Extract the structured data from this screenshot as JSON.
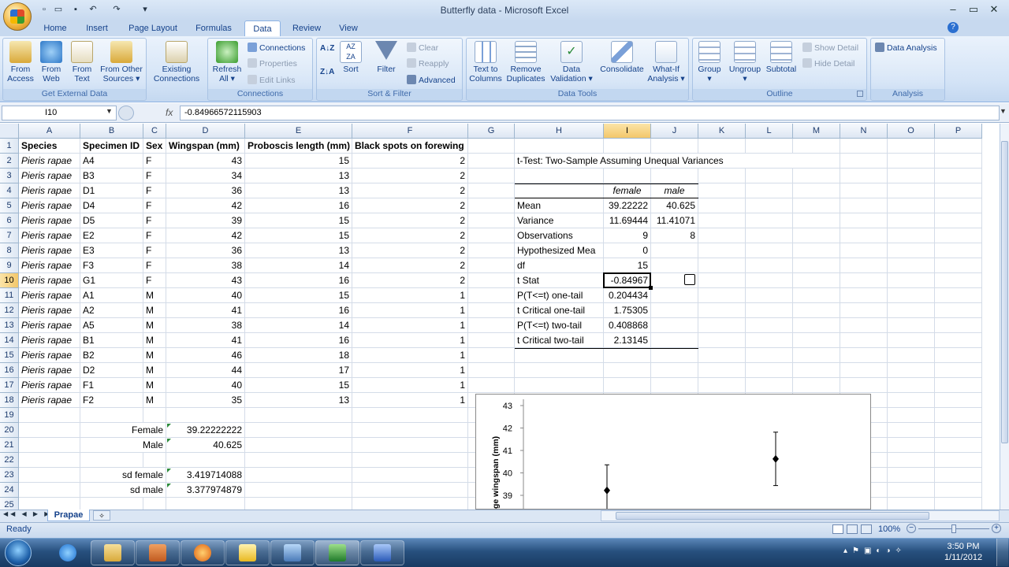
{
  "app": {
    "title": "Butterfly data - Microsoft Excel"
  },
  "tabs": [
    "Home",
    "Insert",
    "Page Layout",
    "Formulas",
    "Data",
    "Review",
    "View"
  ],
  "ribbon": {
    "groups": {
      "external": "Get External Data",
      "connections": "Connections",
      "sort_filter": "Sort & Filter",
      "data_tools": "Data Tools",
      "outline": "Outline",
      "analysis": "Analysis"
    },
    "from_access": [
      "From",
      "Access"
    ],
    "from_web": [
      "From",
      "Web"
    ],
    "from_text": [
      "From",
      "Text"
    ],
    "from_other": [
      "From Other",
      "Sources ▾"
    ],
    "existing": [
      "Existing",
      "Connections"
    ],
    "refresh": [
      "Refresh",
      "All ▾"
    ],
    "connections": "Connections",
    "properties": "Properties",
    "edit_links": "Edit Links",
    "sort": "Sort",
    "filter": "Filter",
    "clear": "Clear",
    "reapply": "Reapply",
    "advanced": "Advanced",
    "text_to_columns": [
      "Text to",
      "Columns"
    ],
    "remove_duplicates": [
      "Remove",
      "Duplicates"
    ],
    "data_validation": [
      "Data",
      "Validation ▾"
    ],
    "consolidate": "Consolidate",
    "what_if": [
      "What-If",
      "Analysis ▾"
    ],
    "group": [
      "Group",
      "▾"
    ],
    "ungroup": [
      "Ungroup",
      "▾"
    ],
    "subtotal": "Subtotal",
    "show_detail": "Show Detail",
    "hide_detail": "Hide Detail",
    "data_analysis": "Data Analysis"
  },
  "formula_bar": {
    "name_box": "I10",
    "fx": "fx",
    "formula": "-0.84966572115903"
  },
  "columns": [
    "A",
    "B",
    "C",
    "D",
    "E",
    "F",
    "G",
    "H",
    "I",
    "J",
    "K",
    "L",
    "M",
    "N",
    "O",
    "P"
  ],
  "rows": [
    "1",
    "2",
    "3",
    "4",
    "5",
    "6",
    "7",
    "8",
    "9",
    "10",
    "11",
    "12",
    "13",
    "14",
    "15",
    "16",
    "17",
    "18",
    "19",
    "20",
    "21",
    "22",
    "23",
    "24",
    "25"
  ],
  "headers": [
    "Species",
    "Specimen ID",
    "Sex",
    "Wingspan (mm)",
    "Proboscis length (mm)",
    "Black spots on forewing"
  ],
  "data": [
    [
      "Pieris rapae",
      "A4",
      "F",
      "43",
      "15",
      "2"
    ],
    [
      "Pieris rapae",
      "B3",
      "F",
      "34",
      "13",
      "2"
    ],
    [
      "Pieris rapae",
      "D1",
      "F",
      "36",
      "13",
      "2"
    ],
    [
      "Pieris rapae",
      "D4",
      "F",
      "42",
      "16",
      "2"
    ],
    [
      "Pieris rapae",
      "D5",
      "F",
      "39",
      "15",
      "2"
    ],
    [
      "Pieris rapae",
      "E2",
      "F",
      "42",
      "15",
      "2"
    ],
    [
      "Pieris rapae",
      "E3",
      "F",
      "36",
      "13",
      "2"
    ],
    [
      "Pieris rapae",
      "F3",
      "F",
      "38",
      "14",
      "2"
    ],
    [
      "Pieris rapae",
      "G1",
      "F",
      "43",
      "16",
      "2"
    ],
    [
      "Pieris rapae",
      "A1",
      "M",
      "40",
      "15",
      "1"
    ],
    [
      "Pieris rapae",
      "A2",
      "M",
      "41",
      "16",
      "1"
    ],
    [
      "Pieris rapae",
      "A5",
      "M",
      "38",
      "14",
      "1"
    ],
    [
      "Pieris rapae",
      "B1",
      "M",
      "41",
      "16",
      "1"
    ],
    [
      "Pieris rapae",
      "B2",
      "M",
      "46",
      "18",
      "1"
    ],
    [
      "Pieris rapae",
      "D2",
      "M",
      "44",
      "17",
      "1"
    ],
    [
      "Pieris rapae",
      "F1",
      "M",
      "40",
      "15",
      "1"
    ],
    [
      "Pieris rapae",
      "F2",
      "M",
      "35",
      "13",
      "1"
    ]
  ],
  "summary": [
    {
      "label": "Female",
      "value": "39.22222222"
    },
    {
      "label": "Male",
      "value": "40.625"
    },
    {
      "label": "sd female",
      "value": "3.419714088"
    },
    {
      "label": "sd male",
      "value": "3.377974879"
    }
  ],
  "ttest": {
    "title": "t-Test: Two-Sample Assuming Unequal Variances",
    "col1": "female",
    "col2": "male",
    "rows": [
      [
        "Mean",
        "39.22222",
        "40.625"
      ],
      [
        "Variance",
        "11.69444",
        "11.41071"
      ],
      [
        "Observations",
        "9",
        "8"
      ],
      [
        "Hypothesized Mea",
        "0",
        ""
      ],
      [
        "df",
        "15",
        ""
      ],
      [
        "t Stat",
        "-0.84967",
        ""
      ],
      [
        "P(T<=t) one-tail",
        "0.204434",
        ""
      ],
      [
        "t Critical one-tail",
        "1.75305",
        ""
      ],
      [
        "P(T<=t) two-tail",
        "0.408868",
        ""
      ],
      [
        "t Critical two-tail",
        "2.13145",
        ""
      ]
    ]
  },
  "chart_data": {
    "type": "scatter",
    "ylabel": "ge wingspan (mm)",
    "yticks": [
      "43",
      "42",
      "41",
      "40",
      "39"
    ],
    "points": [
      {
        "y": 39.22,
        "err": 1.14
      },
      {
        "y": 40.625,
        "err": 1.19
      }
    ]
  },
  "sheet": {
    "tab": "Prapae"
  },
  "status": {
    "text": "Ready",
    "zoom": "100%"
  },
  "clock": {
    "time": "3:50 PM",
    "date": "1/11/2012"
  }
}
